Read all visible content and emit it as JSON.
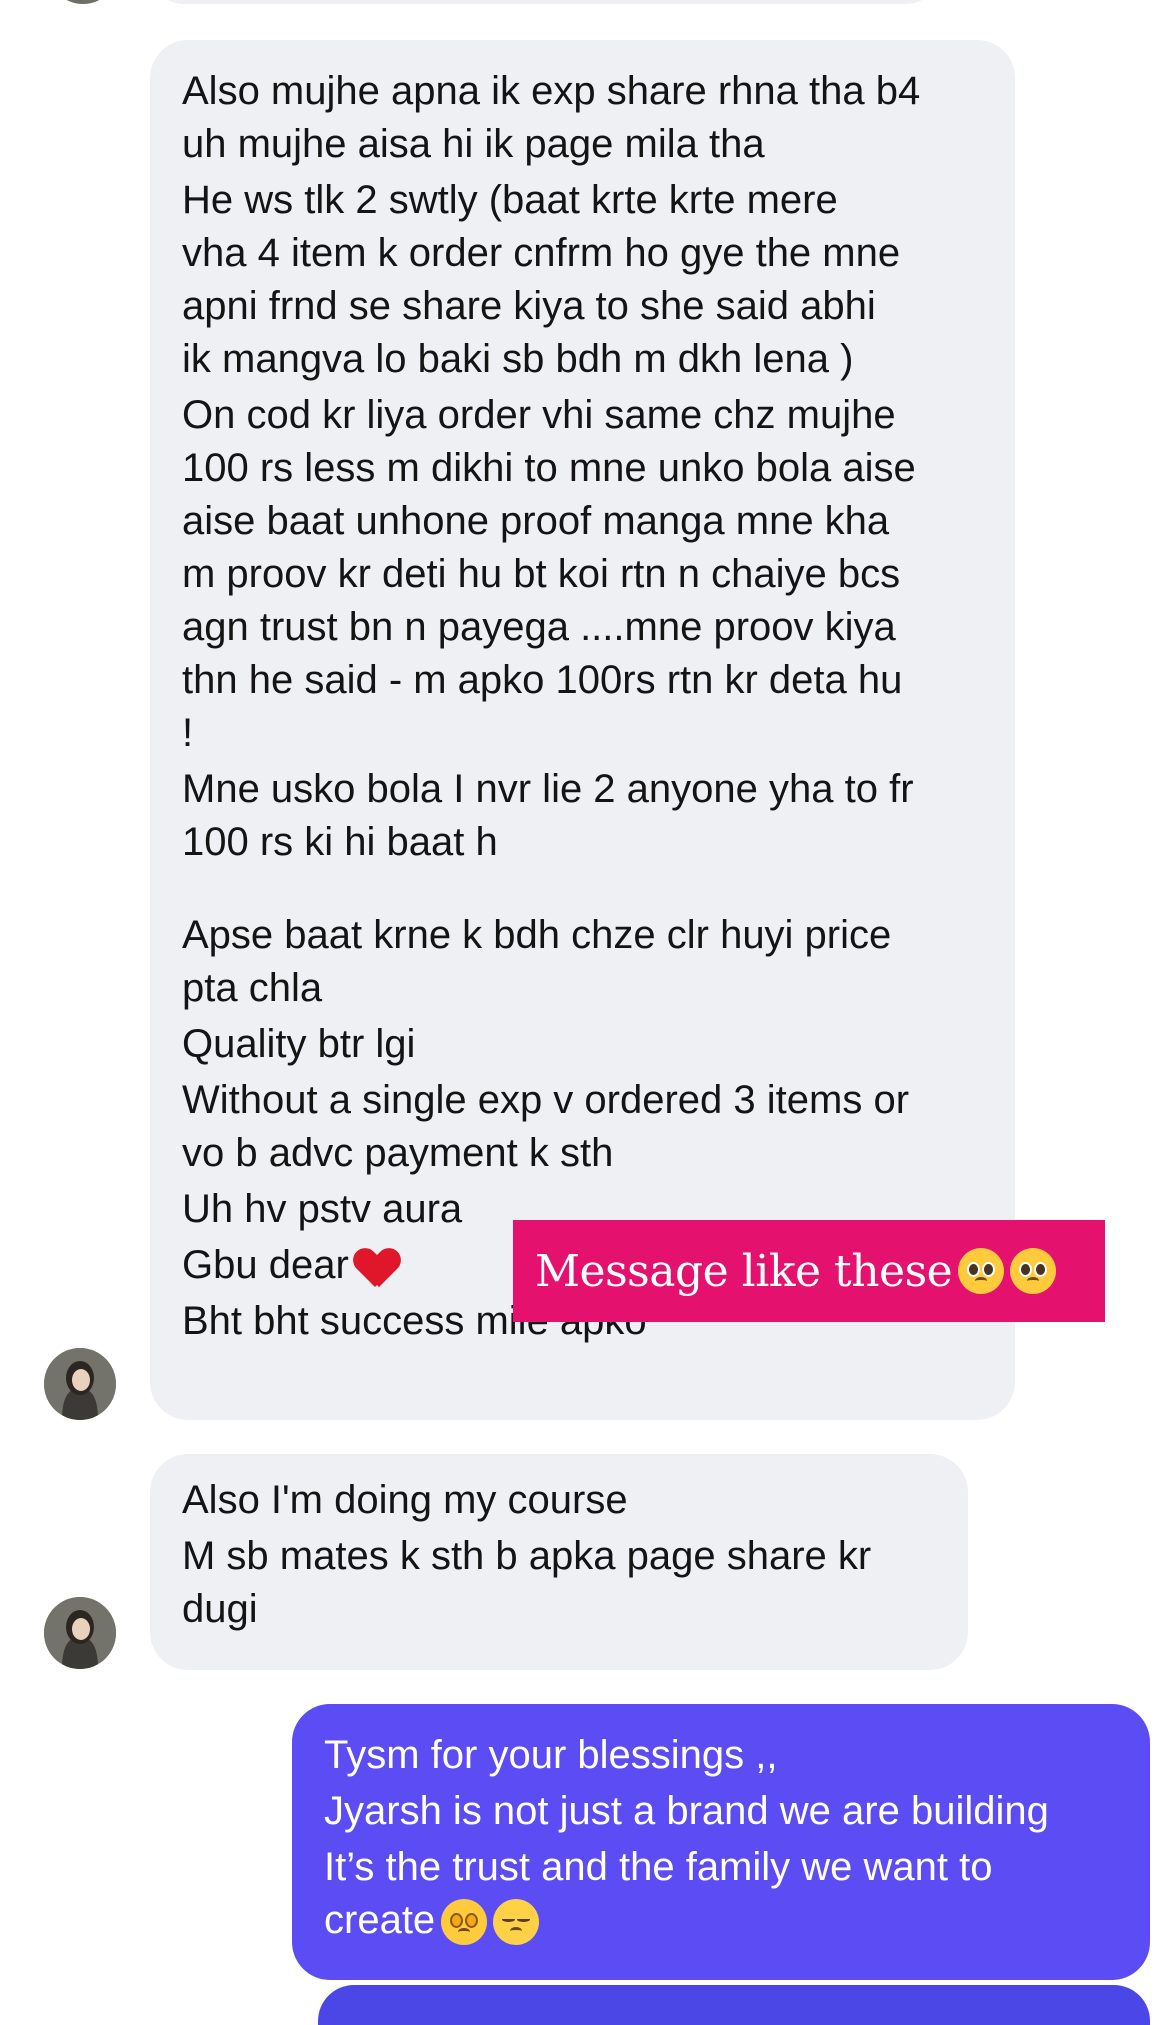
{
  "messages": {
    "incoming_long": [
      "Also mujhe apna ik exp share rhna tha b4",
      "uh mujhe aisa hi ik page mila tha",
      "He ws tlk 2 swtly (baat krte krte mere",
      "vha 4 item k order cnfrm ho gye the mne",
      "apni frnd se share kiya  to she said abhi",
      "ik mangva lo baki sb bdh m dkh lena )",
      "On cod kr liya order vhi same chz mujhe",
      "100 rs less m dikhi to mne unko bola aise",
      "aise baat unhone proof manga mne kha",
      "m proov kr deti hu bt koi rtn n chaiye bcs",
      "agn trust bn n payega ....mne proov kiya",
      "thn he said - m apko 100rs rtn kr deta hu",
      "!",
      "Mne usko bola I nvr lie 2 anyone yha to fr",
      "100 rs ki hi baat h",
      "Apse baat krne k bdh chze clr huyi price",
      "pta chla",
      "Quality btr lgi",
      "Without a single exp v ordered 3 items or",
      "vo b advc payment k sth",
      "Uh hv pstv aura",
      "Gbu dear",
      "Bht bht success mile apko"
    ],
    "incoming_short": [
      "Also I'm doing my course",
      "M sb mates k sth b apka page share kr",
      "dugi"
    ],
    "outgoing": [
      "Tysm for your blessings ,,",
      "Jyarsh is not just a brand we are building",
      "It’s the trust and the family we want to",
      "create"
    ]
  },
  "overlay": {
    "text": "Message like these"
  },
  "colors": {
    "incoming_bubble": "#eff0f3",
    "outgoing_bubble": "#5b4df3",
    "overlay_bg": "#e5116f"
  },
  "icons": {
    "heart": "red-heart-icon",
    "pleading": "pleading-face-icon",
    "starstruck": "star-struck-face-icon",
    "blush": "smiling-blush-face-icon"
  }
}
